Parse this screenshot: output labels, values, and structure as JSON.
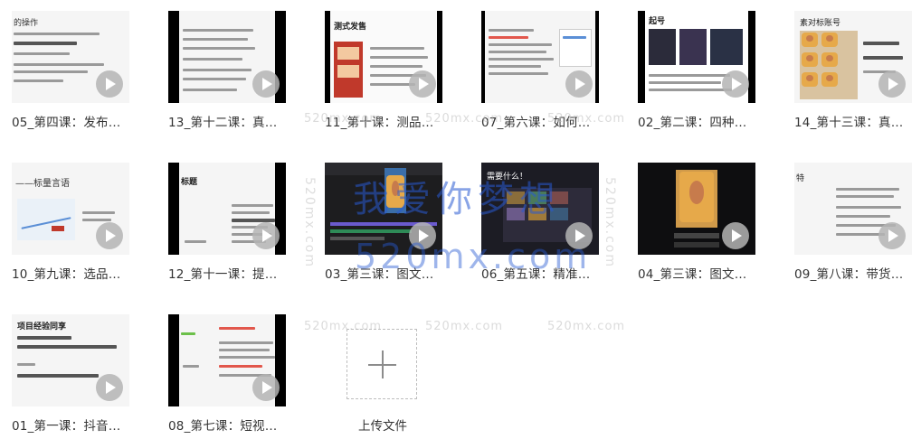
{
  "files": [
    {
      "title": "05_第四课：发布…",
      "thumb_heading": "的操作"
    },
    {
      "title": "13_第十二课：真…",
      "thumb_heading": ""
    },
    {
      "title": "11_第十课：测品…",
      "thumb_heading": "测式发售"
    },
    {
      "title": "07_第六课：如何…",
      "thumb_heading": ""
    },
    {
      "title": "02_第二课：四种…",
      "thumb_heading": "起号"
    },
    {
      "title": "14_第十三课：真…",
      "thumb_heading": "素对标账号"
    },
    {
      "title": "10_第九课：选品…",
      "thumb_heading": "——标量言语"
    },
    {
      "title": "12_第十一课：提…",
      "thumb_heading": "标题"
    },
    {
      "title": "03_第三课：图文…",
      "thumb_heading": ""
    },
    {
      "title": "06_第五课：精准…",
      "thumb_heading": "需要什么！"
    },
    {
      "title": "04_第三课：图文…",
      "thumb_heading": ""
    },
    {
      "title": "09_第八课：带货…",
      "thumb_heading": "特"
    },
    {
      "title": "01_第一课：抖音…",
      "thumb_heading": "项目经验同享"
    },
    {
      "title": "08_第七课：短视…",
      "thumb_heading": ""
    }
  ],
  "upload": {
    "label": "上传文件"
  },
  "watermarks": {
    "main_cn": "我爱你梦想",
    "main_en": "520mx.com",
    "small": "520mx.com",
    "vertical": "520mx.com"
  }
}
